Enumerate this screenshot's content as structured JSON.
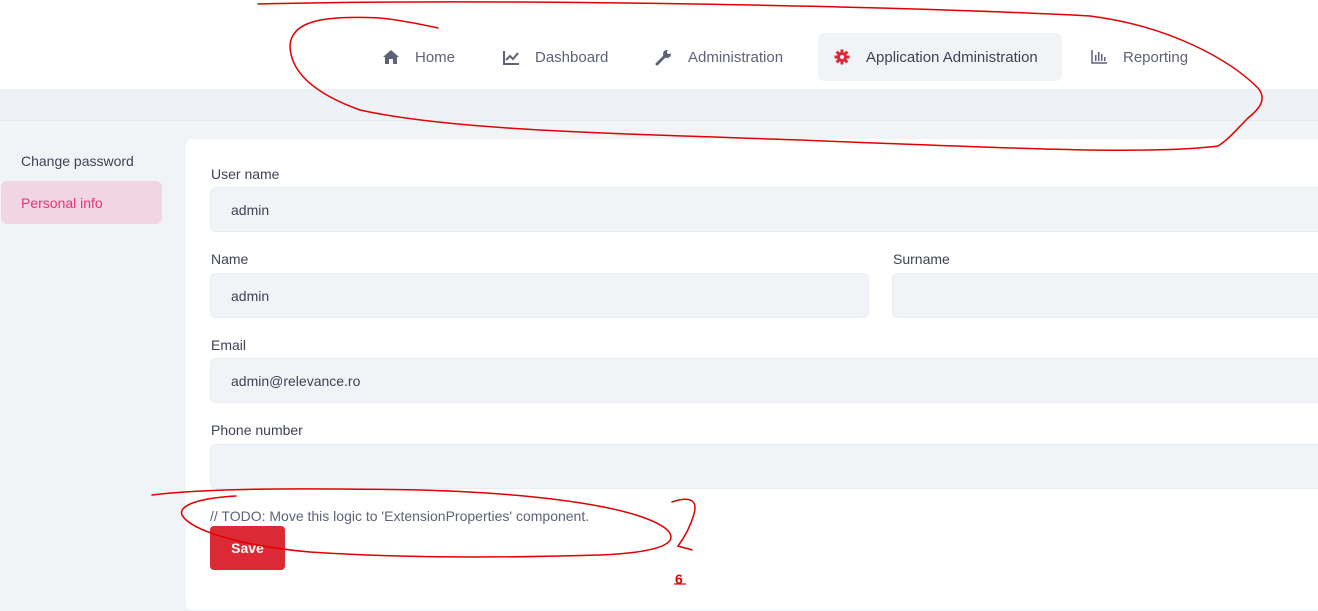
{
  "nav": {
    "items": [
      {
        "label": "Home",
        "icon": "home-icon"
      },
      {
        "label": "Dashboard",
        "icon": "chart-line-icon"
      },
      {
        "label": "Administration",
        "icon": "wrench-icon"
      },
      {
        "label": "Application Administration",
        "icon": "gear-icon"
      },
      {
        "label": "Reporting",
        "icon": "bar-chart-icon"
      }
    ],
    "active_index": 3
  },
  "sidebar": {
    "items": [
      {
        "label": "Change password"
      },
      {
        "label": "Personal info"
      }
    ],
    "active_index": 1
  },
  "form": {
    "username_label": "User name",
    "username_value": "admin",
    "name_label": "Name",
    "name_value": "admin",
    "surname_label": "Surname",
    "surname_value": "",
    "email_label": "Email",
    "email_value": "admin@relevance.ro",
    "phone_label": "Phone number",
    "phone_value": "",
    "todo_note": "// TODO: Move this logic to 'ExtensionProperties' component.",
    "save_label": "Save"
  },
  "annotations": {
    "marker_text": "6",
    "color": "#e00000"
  },
  "colors": {
    "accent": "#db2a36",
    "active_sidebar_bg": "#f2d5e2",
    "active_sidebar_text": "#e4337a",
    "gear_icon": "#db2a36"
  }
}
